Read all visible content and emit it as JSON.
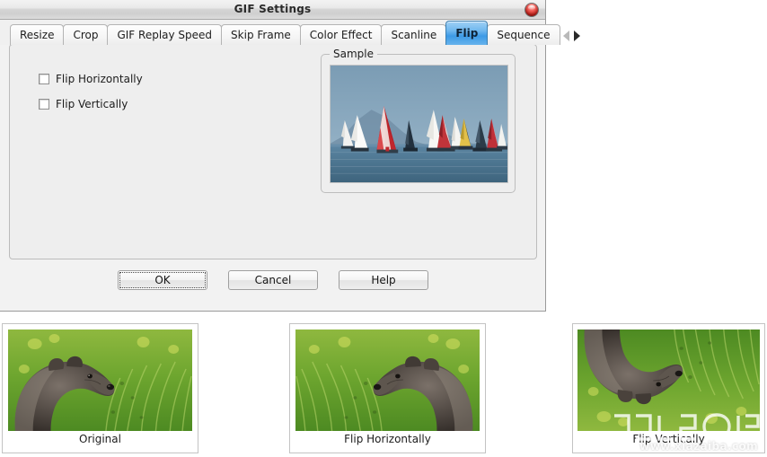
{
  "window": {
    "title": "GIF Settings",
    "close_icon": "close-orb-icon"
  },
  "tabs": [
    {
      "label": "Resize",
      "active": false
    },
    {
      "label": "Crop",
      "active": false
    },
    {
      "label": "GIF Replay Speed",
      "active": false
    },
    {
      "label": "Skip Frame",
      "active": false
    },
    {
      "label": "Color Effect",
      "active": false
    },
    {
      "label": "Scanline",
      "active": false
    },
    {
      "label": "Flip",
      "active": true
    },
    {
      "label": "Sequence",
      "active": false
    }
  ],
  "tab_scroll": {
    "left_icon": "scroll-left-arrow-icon",
    "right_icon": "scroll-right-arrow-icon",
    "left_enabled": "false",
    "right_enabled": "true"
  },
  "flip_panel": {
    "checkboxes": [
      {
        "label": "Flip Horizontally",
        "checked": false
      },
      {
        "label": "Flip Vertically",
        "checked": false
      }
    ],
    "sample_group_title": "Sample",
    "sample_image_alt": "sailboat-regatta-preview"
  },
  "actions": {
    "ok": "OK",
    "cancel": "Cancel",
    "help": "Help"
  },
  "thumbnails": [
    {
      "caption": "Original",
      "alt": "marmot-facing-right"
    },
    {
      "caption": "Flip Horizontally",
      "alt": "marmot-facing-left"
    },
    {
      "caption": "Flip Vertically",
      "alt": "marmot-upside-down"
    }
  ],
  "watermark": {
    "url": "www.xiazaiba.com"
  },
  "colors": {
    "active_tab": "#3d9ae6",
    "dialog_bg": "#f2f2f2",
    "panel_bg": "#eeeeee",
    "page_bg": "#ffffff",
    "close_button": "#c92a22"
  }
}
